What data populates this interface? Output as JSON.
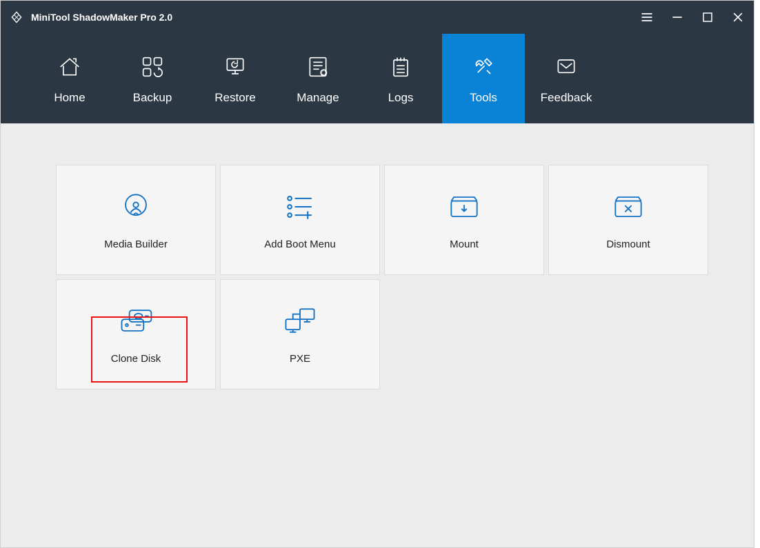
{
  "app": {
    "title": "MiniTool ShadowMaker Pro 2.0"
  },
  "nav": {
    "items": [
      {
        "id": "home",
        "label": "Home",
        "icon": "home-icon"
      },
      {
        "id": "backup",
        "label": "Backup",
        "icon": "backup-icon"
      },
      {
        "id": "restore",
        "label": "Restore",
        "icon": "restore-icon"
      },
      {
        "id": "manage",
        "label": "Manage",
        "icon": "manage-icon"
      },
      {
        "id": "logs",
        "label": "Logs",
        "icon": "logs-icon"
      },
      {
        "id": "tools",
        "label": "Tools",
        "icon": "tools-icon",
        "active": true
      },
      {
        "id": "feedback",
        "label": "Feedback",
        "icon": "feedback-icon"
      }
    ]
  },
  "tools": {
    "cards": [
      {
        "id": "media-builder",
        "label": "Media Builder",
        "icon": "media-builder-icon"
      },
      {
        "id": "add-boot-menu",
        "label": "Add Boot Menu",
        "icon": "add-boot-menu-icon"
      },
      {
        "id": "mount",
        "label": "Mount",
        "icon": "mount-icon"
      },
      {
        "id": "dismount",
        "label": "Dismount",
        "icon": "dismount-icon"
      },
      {
        "id": "clone-disk",
        "label": "Clone Disk",
        "icon": "clone-disk-icon",
        "highlight": true
      },
      {
        "id": "pxe",
        "label": "PXE",
        "icon": "pxe-icon"
      }
    ]
  },
  "colors": {
    "accent": "#1472c4",
    "navbg": "#2b3742",
    "activebg": "#0a83d6"
  }
}
